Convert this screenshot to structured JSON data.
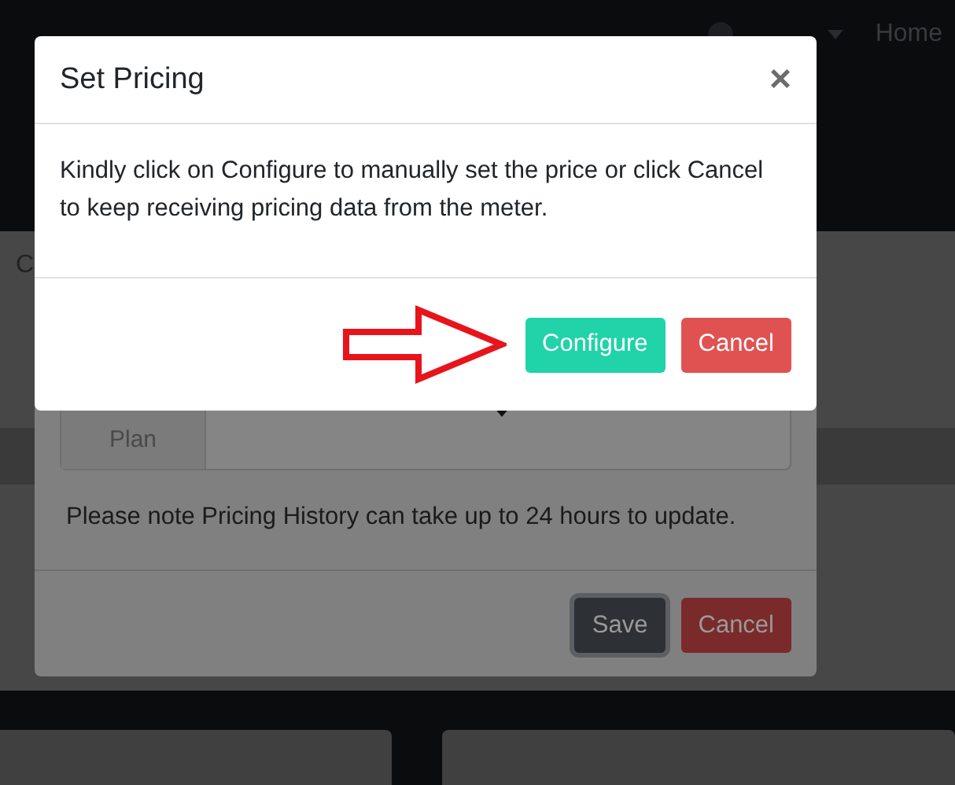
{
  "navbar": {
    "home_link": "Home"
  },
  "side_tab": {
    "label": "C"
  },
  "background_dialog": {
    "plan_label": "Plan",
    "note": "Please note Pricing History can take up to 24 hours to update.",
    "buttons": [
      {
        "label": "Save",
        "kind": "dark",
        "focused": true
      },
      {
        "label": "Cancel",
        "kind": "danger",
        "focused": false
      }
    ]
  },
  "dialog": {
    "title": "Set Pricing",
    "close": "×",
    "message": "Kindly click on Configure to manually set the price or click Cancel to keep receiving pricing data from the meter.",
    "buttons": [
      {
        "label": "Configure",
        "kind": "success",
        "focused": false
      },
      {
        "label": "Cancel",
        "kind": "danger",
        "focused": false
      }
    ]
  }
}
